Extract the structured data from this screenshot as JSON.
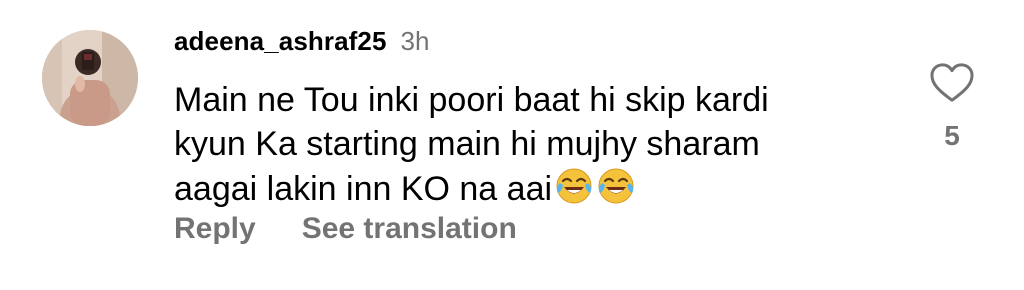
{
  "comment": {
    "username": "adeena_ashraf25",
    "timestamp": "3h",
    "text_line1": "Main ne Tou inki poori baat hi skip kardi",
    "text_line2": "kyun Ka starting main hi mujhy sharam",
    "text_line3": "aagai lakin inn KO na aai",
    "emojis": [
      "face-with-tears-of-joy",
      "face-with-tears-of-joy"
    ],
    "emoji_text": "😂😂",
    "like_count": "5",
    "reply_label": "Reply",
    "translate_label": "See translation",
    "like_icon": "heart-outline-icon"
  },
  "colors": {
    "secondary_text": "#737373",
    "primary_text": "#000000",
    "background": "#ffffff"
  }
}
